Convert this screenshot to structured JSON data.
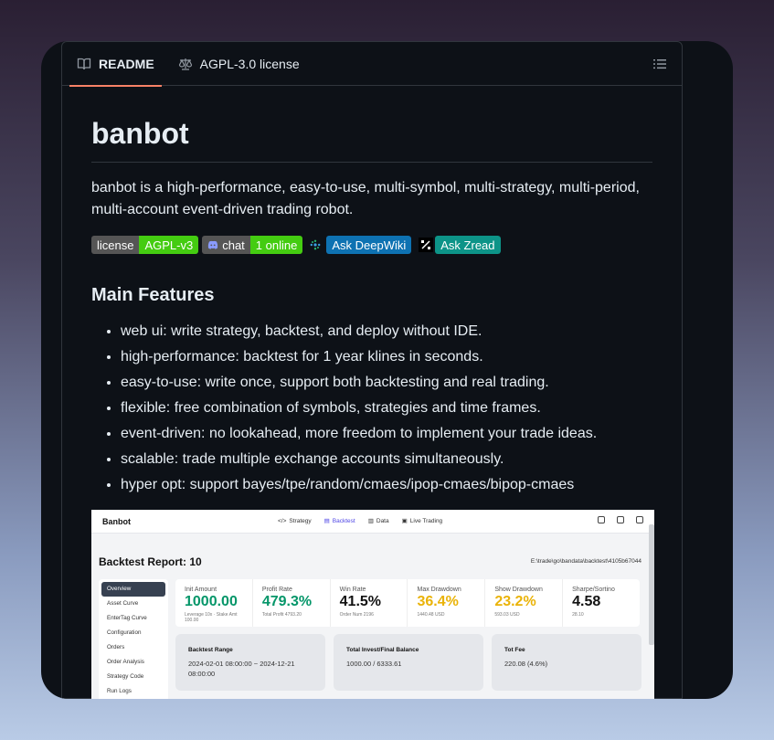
{
  "tabs": [
    {
      "label": "README",
      "icon": "book-icon",
      "active": true
    },
    {
      "label": "AGPL-3.0 license",
      "icon": "scale-icon",
      "active": false
    }
  ],
  "readme": {
    "title": "banbot",
    "description": "banbot is a high-performance, easy-to-use, multi-symbol, multi-strategy, multi-period, multi-account event-driven trading robot.",
    "badges": {
      "license_left": "license",
      "license_right": "AGPL-v3",
      "chat_left": "chat",
      "chat_right": "1 online",
      "deepwiki": "Ask DeepWiki",
      "zread": "Ask Zread"
    },
    "features_heading": "Main Features",
    "features": [
      "web ui: write strategy, backtest, and deploy without IDE.",
      "high-performance: backtest for 1 year klines in seconds.",
      "easy-to-use: write once, support both backtesting and real trading.",
      "flexible: free combination of symbols, strategies and time frames.",
      "event-driven: no lookahead, more freedom to implement your trade ideas.",
      "scalable: trade multiple exchange accounts simultaneously.",
      "hyper opt: support bayes/tpe/random/cmaes/ipop-cmaes/bipop-cmaes"
    ]
  },
  "screenshot": {
    "brand": "Banbot",
    "nav": [
      "Strategy",
      "Backtest",
      "Data",
      "Live Trading"
    ],
    "report_title": "Backtest Report: 10",
    "path": "E:\\trade\\go\\bandata\\backtest\\4105b67044",
    "sidebar": [
      "Overview",
      "Asset Curve",
      "EnterTag Curve",
      "Configuration",
      "Orders",
      "Order Analysis",
      "Strategy Code",
      "Run Logs"
    ],
    "stats": [
      {
        "label": "Init Amount",
        "value": "1000.00",
        "sub": "Leverage 10x · Stake Amt 100.00",
        "color": "#059669"
      },
      {
        "label": "Profit Rate",
        "value": "479.3%",
        "sub": "Total Profit 4793.20",
        "color": "#059669"
      },
      {
        "label": "Win Rate",
        "value": "41.5%",
        "sub": "Order Num 2196",
        "color": "#111111"
      },
      {
        "label": "Max Drawdown",
        "value": "36.4%",
        "sub": "1440.48 USD",
        "color": "#eab308"
      },
      {
        "label": "Show Drawdown",
        "value": "23.2%",
        "sub": "593.03 USD",
        "color": "#eab308"
      },
      {
        "label": "Sharpe/Sortino",
        "value": "4.58",
        "sub": "28.10",
        "color": "#111111"
      }
    ],
    "boxes": [
      {
        "label": "Backtest Range",
        "value": "2024-02-01 08:00:00 ~ 2024-12-21 08:00:00"
      },
      {
        "label": "Total Invest/Final Balance",
        "value": "1000.00 / 6333.61"
      },
      {
        "label": "Tot Fee",
        "value": "220.08 (4.6%)"
      }
    ]
  }
}
